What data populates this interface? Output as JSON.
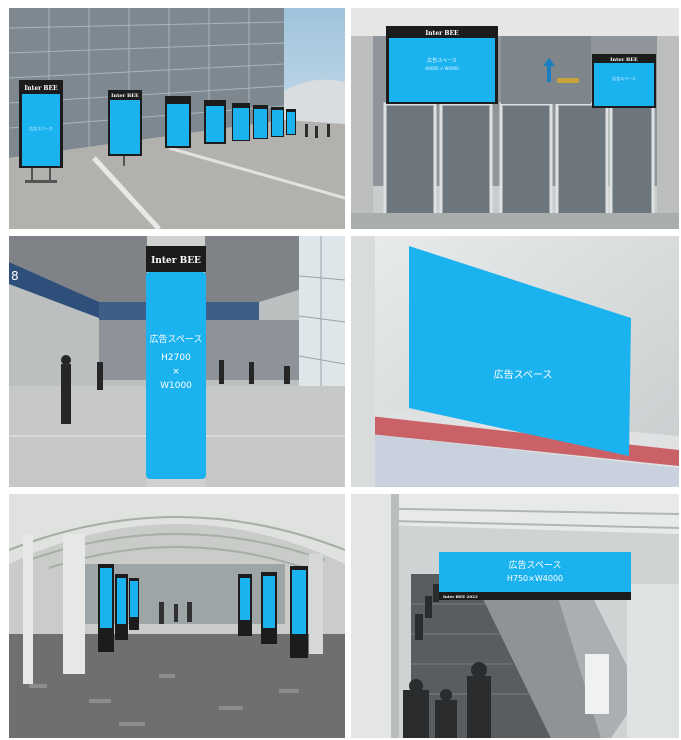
{
  "colors": {
    "ad_blue": "#1ab2ef",
    "frame_black": "#1c1c1c"
  },
  "brand": {
    "logo_text": "Inter BEE"
  },
  "panels": {
    "p1": {
      "sign_text": "広告スペース"
    },
    "p2": {
      "line1": "広告スペース",
      "line2": "H0000 × W0000"
    },
    "p3": {
      "line1": "広告スペース",
      "line2": "H2700",
      "line3": "×",
      "line4": "W1000"
    },
    "p4": {
      "line1": "広告スペース"
    },
    "p6": {
      "line1": "広告スペース",
      "line2": "H750×W4000",
      "footer": "Inter BEE 2023"
    }
  }
}
